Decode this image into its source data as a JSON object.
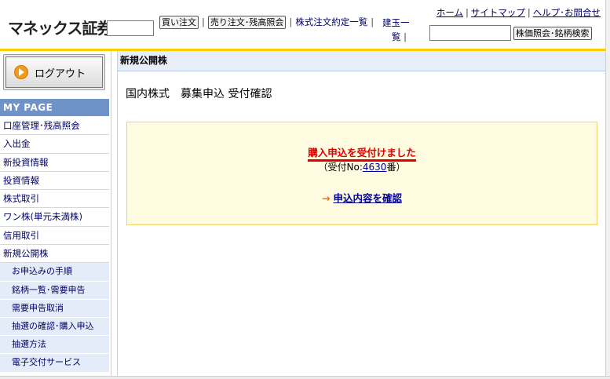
{
  "header": {
    "logo": "マネックス証券",
    "nav": {
      "buy": "買い注文",
      "sell": "売り注文･残高照会",
      "orders": "株式注文約定一覧",
      "positions_a": "建玉一",
      "positions_b": "覧"
    },
    "toplinks": {
      "home": "ホーム",
      "sitemap": "サイトマップ",
      "help": "ヘルプ･お問合せ"
    },
    "search_button": "株価照会･銘柄検索"
  },
  "sidebar": {
    "logout": "ログアウト",
    "mypage": "MY PAGE",
    "items": [
      "口座管理･残高照会",
      "入出金",
      "新投資情報",
      "投資情報",
      "株式取引",
      "ワン株(単元未満株)",
      "信用取引",
      "新規公開株"
    ],
    "subitems": [
      "お申込みの手順",
      "銘柄一覧･需要申告",
      "需要申告取消",
      "抽選の確認･購入申込",
      "抽選方法",
      "電子交付サービス"
    ]
  },
  "main": {
    "header": "新規公開株",
    "title": "国内株式　募集申込 受付確認",
    "notice": {
      "title": "購入申込を受付けました",
      "sub_prefix": "（受付No:",
      "sub_number": "4630",
      "sub_suffix": "番）",
      "arrow": "→",
      "confirm_link": "申込内容を確認"
    }
  },
  "colors": {
    "accent_yellow": "#ffcc00",
    "mypage_blue": "#6f93c9",
    "alert_red": "#e00000",
    "link_blue": "#000099"
  }
}
